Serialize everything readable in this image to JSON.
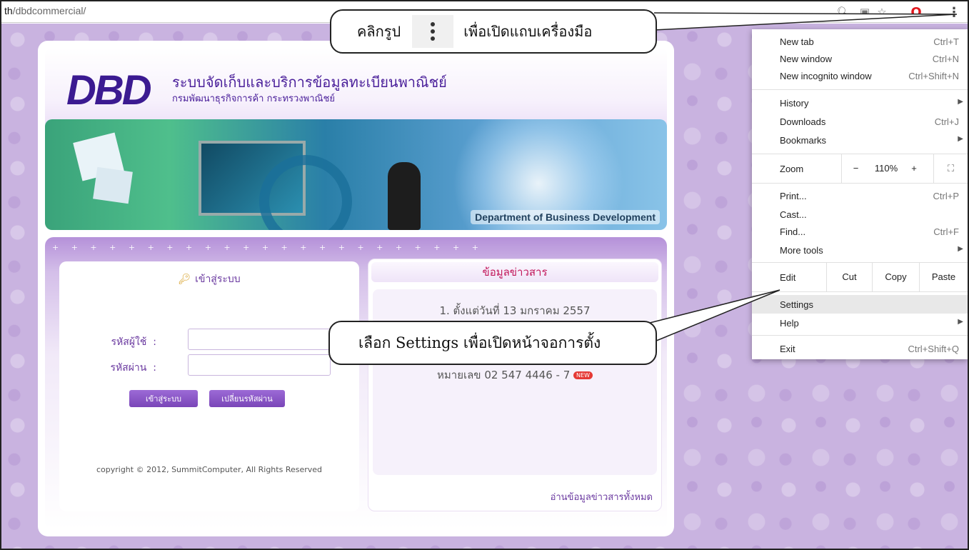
{
  "browser": {
    "url_host": "th",
    "url_path": "/dbdcommercial/"
  },
  "site": {
    "logo_text": "DBD",
    "title": "ระบบจัดเก็บและบริการข้อมูลทะเบียนพาณิชย์",
    "subtitle": "กรมพัฒนาธุรกิจการค้า กระทรวงพาณิชย์",
    "banner_caption": "Department of Business Development"
  },
  "login": {
    "title": "เข้าสู่ระบบ",
    "username_label": "รหัสผู้ใช้",
    "password_label": "รหัสผ่าน",
    "colon": ":",
    "login_button": "เข้าสู่ระบบ",
    "change_password_button": "เปลี่ยนรหัสผ่าน",
    "copyright": "copyright © 2012, SummitComputer, All Rights Reserved"
  },
  "news": {
    "title": "ข้อมูลข่าวสาร",
    "item_1": "1. ตั้งแต่วันที่ 13 มกราคม 2557",
    "phone": "หมายเลข 02 547 4446 - 7",
    "new_badge": "NEW",
    "read_all": "อ่านข้อมูลข่าวสารทั้งหมด"
  },
  "menu": {
    "new_tab": {
      "label": "New tab",
      "shortcut": "Ctrl+T"
    },
    "new_window": {
      "label": "New window",
      "shortcut": "Ctrl+N"
    },
    "new_incognito": {
      "label": "New incognito window",
      "shortcut": "Ctrl+Shift+N"
    },
    "history": {
      "label": "History"
    },
    "downloads": {
      "label": "Downloads",
      "shortcut": "Ctrl+J"
    },
    "bookmarks": {
      "label": "Bookmarks"
    },
    "zoom": {
      "label": "Zoom",
      "minus": "−",
      "value": "110%",
      "plus": "+"
    },
    "print": {
      "label": "Print...",
      "shortcut": "Ctrl+P"
    },
    "cast": {
      "label": "Cast..."
    },
    "find": {
      "label": "Find...",
      "shortcut": "Ctrl+F"
    },
    "more_tools": {
      "label": "More tools"
    },
    "edit": {
      "label": "Edit",
      "cut": "Cut",
      "copy": "Copy",
      "paste": "Paste"
    },
    "settings": {
      "label": "Settings"
    },
    "help": {
      "label": "Help"
    },
    "exit": {
      "label": "Exit",
      "shortcut": "Ctrl+Shift+Q"
    }
  },
  "callouts": {
    "top_before": "คลิกรูป",
    "top_after": "เพื่อเปิดแถบเครื่องมือ",
    "bottom": "เลือก Settings เพื่อเปิดหน้าจอการตั้ง"
  },
  "icons": {
    "toolbar": [
      "search-icon",
      "extension-icon",
      "star-icon",
      "opera-icon",
      "menu-dots-icon"
    ],
    "accent": "#6b3aa0",
    "news_title_color": "#c2185b"
  }
}
